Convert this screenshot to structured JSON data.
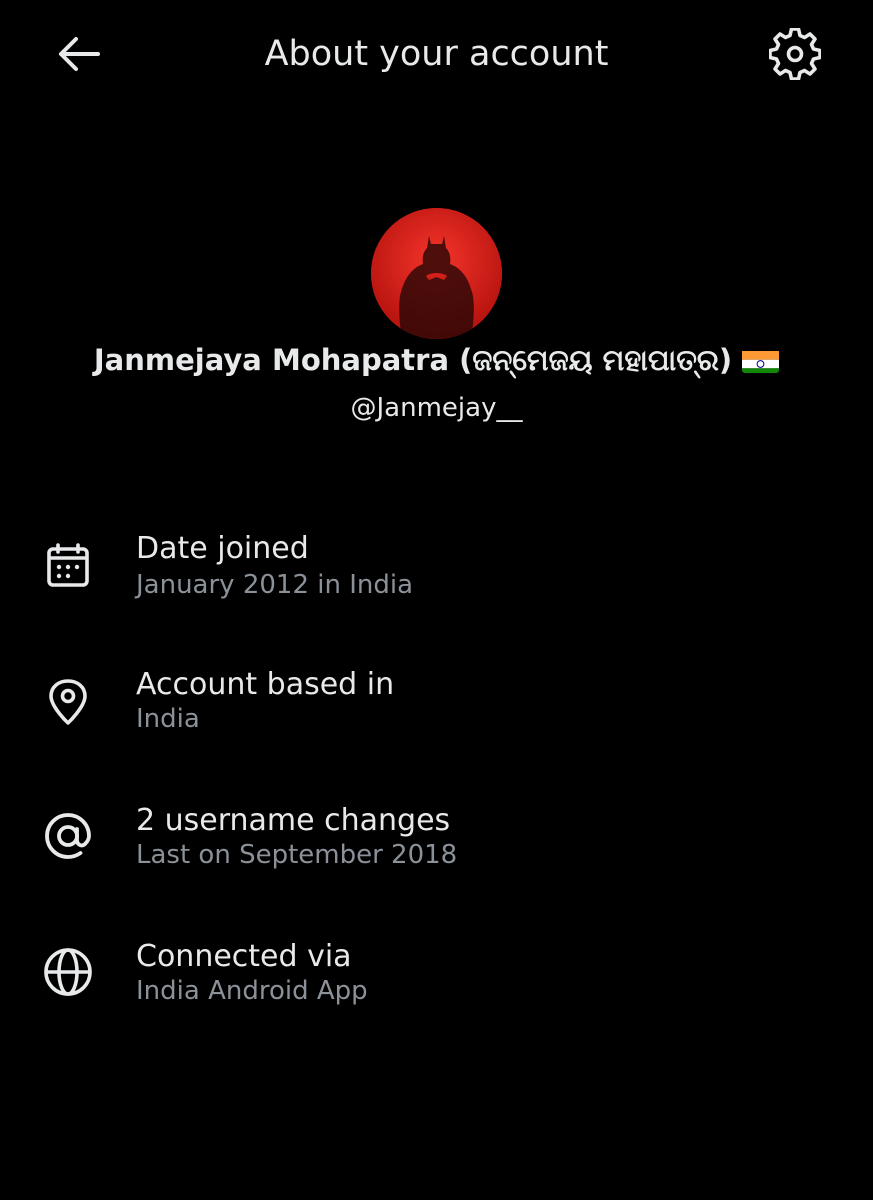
{
  "header": {
    "title": "About your account",
    "back_icon": "arrow-left-icon",
    "settings_icon": "gear-icon"
  },
  "profile": {
    "display_name": "Janmejaya Mohapatra (ଜନ୍ମେଜୟ ମହାପାତ୍ର)",
    "flag": "🇮🇳",
    "handle": "@Janmejay__",
    "avatar_color": "#e2231b"
  },
  "info": [
    {
      "icon": "calendar-icon",
      "title": "Date joined",
      "subtitle": "January 2012 in India"
    },
    {
      "icon": "location-pin-icon",
      "title": "Account based in",
      "subtitle": "India"
    },
    {
      "icon": "at-sign-icon",
      "title": "2 username changes",
      "subtitle": "Last on September 2018"
    },
    {
      "icon": "globe-icon",
      "title": "Connected via",
      "subtitle": "India Android App"
    }
  ],
  "colors": {
    "background": "#000000",
    "primary_text": "#e7e9ea",
    "secondary_text": "#8b9198"
  }
}
